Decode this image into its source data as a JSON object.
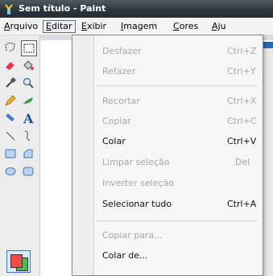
{
  "window": {
    "title": "Sem título - Paint"
  },
  "menubar": {
    "items": [
      {
        "first": "A",
        "rest": "rquivo"
      },
      {
        "first": "E",
        "rest": "ditar"
      },
      {
        "first": "E",
        "rest": "xibir"
      },
      {
        "first": "I",
        "rest": "magem"
      },
      {
        "first": "C",
        "rest": "ores"
      },
      {
        "first": "Aj",
        "rest": "u"
      }
    ]
  },
  "edit_menu": {
    "undo": {
      "label": "Desfazer",
      "shortcut": "Ctrl+Z"
    },
    "redo": {
      "label": "Refazer",
      "shortcut": "Ctrl+Y"
    },
    "cut": {
      "label": "Recortar",
      "shortcut": "Ctrl+X"
    },
    "copy": {
      "label": "Copiar",
      "shortcut": "Ctrl+C"
    },
    "paste": {
      "label": "Colar",
      "shortcut": "Ctrl+V"
    },
    "clear_selection": {
      "label": "Limpar seleção",
      "shortcut": "Del"
    },
    "invert_selection": {
      "label": "Inverter seleção"
    },
    "select_all": {
      "label": "Selecionar tudo",
      "shortcut": "Ctrl+A"
    },
    "copy_to": {
      "label": "Copiar para..."
    },
    "paste_from": {
      "label": "Colar de..."
    }
  },
  "toolbox": {
    "text_tool_glyph": "A"
  },
  "colors": {
    "foreground": "#f04a4a",
    "background": "#48c048"
  }
}
